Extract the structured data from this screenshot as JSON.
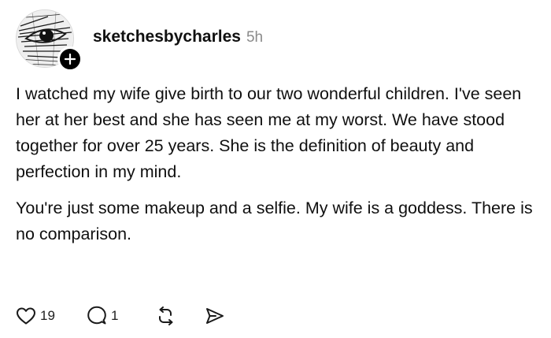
{
  "post": {
    "username": "sketchesbycharles",
    "timestamp": "5h",
    "paragraphs": [
      "I watched my wife give birth to our two wonderful children. I've seen her at her best and she has seen me at my worst. We have stood together for over 25 years. She is the definition of beauty and perfection in my mind.",
      "You're just some makeup and a selfie. My wife is a goddess. There is no comparison."
    ],
    "avatar_icon": "sketched-eye-avatar",
    "follow_icon": "plus-icon"
  },
  "actions": {
    "like_count": "19",
    "reply_count": "1",
    "like_icon": "heart-icon",
    "reply_icon": "comment-icon",
    "repost_icon": "repost-icon",
    "share_icon": "send-icon"
  }
}
